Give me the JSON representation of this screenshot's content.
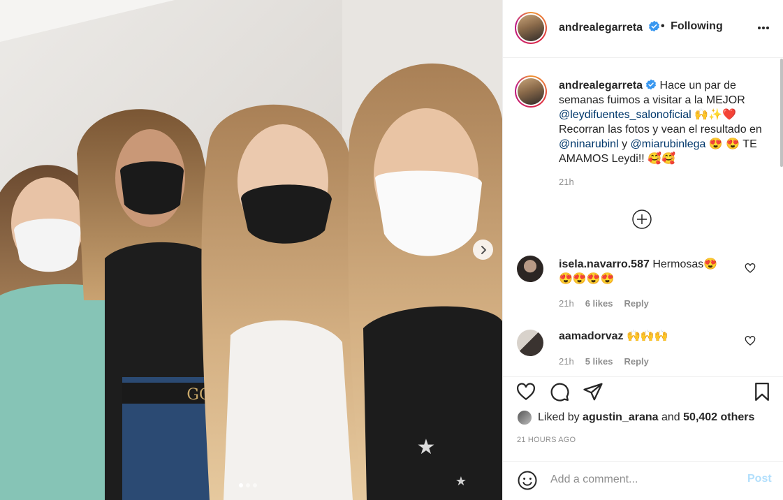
{
  "post": {
    "username": "andrealegarreta",
    "follow_status": "Following",
    "separator": "•",
    "caption": {
      "part1": "Hace un par de semanas fuimos a visitar a la MEJOR",
      "mention1": "@leydifuentes_salonoficial",
      "emojis1": "🙌✨❤️",
      "part2": "Recorran las fotos y vean el resultado en",
      "mention2": "@ninarubinl",
      "and": "y",
      "mention3": "@miarubinlega",
      "emojis2": "😍",
      "part3": "😍 TE AMAMOS Leydi!! 🥰🥰"
    },
    "caption_time": "21h"
  },
  "comments": [
    {
      "username": "isela.navarro.587",
      "text": "Hermosas😍",
      "text2": "😍😍😍😍",
      "time": "21h",
      "likes": "6 likes",
      "reply": "Reply"
    },
    {
      "username": "aamadorvaz",
      "text": "🙌🙌🙌",
      "time": "21h",
      "likes": "5 likes",
      "reply": "Reply"
    }
  ],
  "likes": {
    "prefix": "Liked by",
    "user": "agustin_arana",
    "and": "and",
    "count": "50,402 others"
  },
  "timestamp": "21 HOURS AGO",
  "add_comment": {
    "placeholder": "Add a comment...",
    "post_label": "Post"
  },
  "carousel": {
    "total": 3,
    "active": 1
  },
  "colors": {
    "link": "#00376b",
    "muted": "#8e8e8e",
    "verified": "#3897f0",
    "post_disabled": "#b2dffc"
  }
}
